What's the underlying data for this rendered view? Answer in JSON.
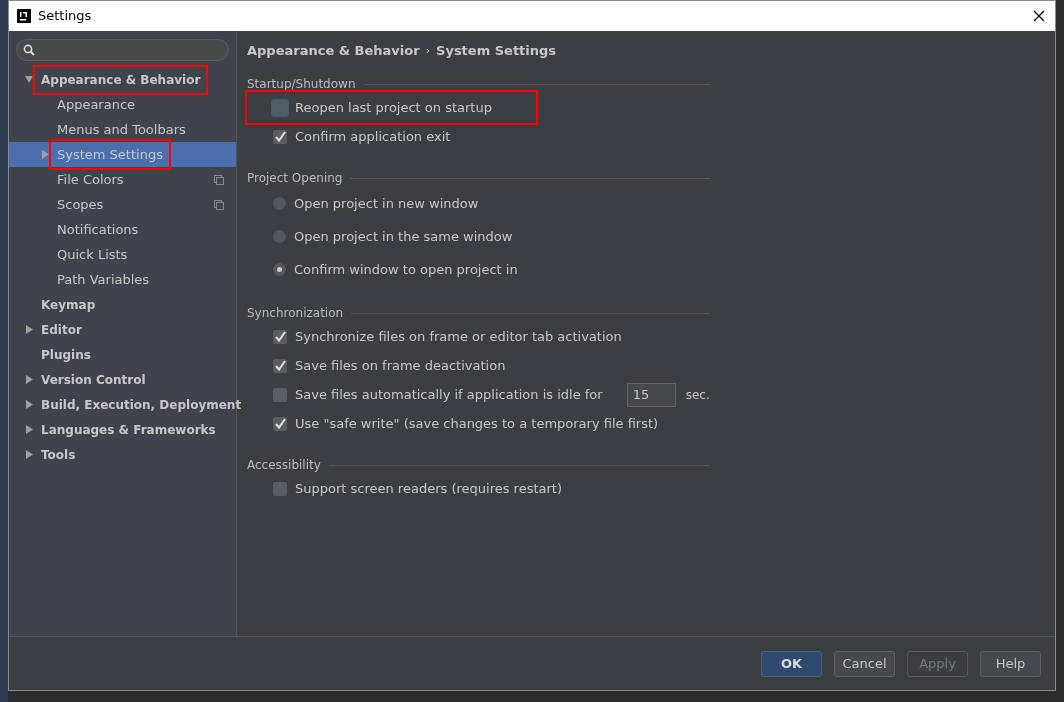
{
  "window": {
    "title": "Settings"
  },
  "sidebar": {
    "items": [
      {
        "label": "Appearance & Behavior",
        "expanded": true,
        "selected": false,
        "highlighted": true,
        "children": [
          {
            "label": "Appearance",
            "selected": false
          },
          {
            "label": "Menus and Toolbars",
            "selected": false
          },
          {
            "label": "System Settings",
            "expanded": false,
            "selected": true,
            "highlighted": true
          },
          {
            "label": "File Colors",
            "selected": false,
            "copy_icon": true
          },
          {
            "label": "Scopes",
            "selected": false,
            "copy_icon": true
          },
          {
            "label": "Notifications",
            "selected": false
          },
          {
            "label": "Quick Lists",
            "selected": false
          },
          {
            "label": "Path Variables",
            "selected": false
          }
        ]
      },
      {
        "label": "Keymap",
        "selected": false
      },
      {
        "label": "Editor",
        "expanded": false,
        "selected": false
      },
      {
        "label": "Plugins",
        "selected": false
      },
      {
        "label": "Version Control",
        "expanded": false,
        "selected": false
      },
      {
        "label": "Build, Execution, Deployment",
        "expanded": false,
        "selected": false
      },
      {
        "label": "Languages & Frameworks",
        "expanded": false,
        "selected": false
      },
      {
        "label": "Tools",
        "expanded": false,
        "selected": false
      }
    ]
  },
  "breadcrumb": {
    "parts": [
      "Appearance & Behavior",
      "System Settings"
    ],
    "separator": "›"
  },
  "sections": [
    {
      "title": "Startup/Shutdown",
      "items": [
        {
          "kind": "checkbox",
          "label": "Reopen last project on startup",
          "checked": false,
          "focused": true,
          "highlighted": true
        },
        {
          "kind": "checkbox",
          "label": "Confirm application exit",
          "checked": true
        }
      ]
    },
    {
      "title": "Project Opening",
      "items": [
        {
          "kind": "radio",
          "label": "Open project in new window",
          "selected": false
        },
        {
          "kind": "radio",
          "label": "Open project in the same window",
          "selected": false
        },
        {
          "kind": "radio",
          "label": "Confirm window to open project in",
          "selected": true
        }
      ]
    },
    {
      "title": "Synchronization",
      "items": [
        {
          "kind": "checkbox",
          "label": "Synchronize files on frame or editor tab activation",
          "checked": true
        },
        {
          "kind": "checkbox",
          "label": "Save files on frame deactivation",
          "checked": true
        },
        {
          "kind": "checkbox_field",
          "label": "Save files automatically if application is idle for",
          "checked": false,
          "value": "15",
          "unit": "sec."
        },
        {
          "kind": "checkbox",
          "label": "Use \"safe write\" (save changes to a temporary file first)",
          "checked": true
        }
      ]
    },
    {
      "title": "Accessibility",
      "items": [
        {
          "kind": "checkbox",
          "label": "Support screen readers (requires restart)",
          "checked": false
        }
      ]
    }
  ],
  "buttons": [
    {
      "label": "OK",
      "default": true,
      "disabled": false
    },
    {
      "label": "Cancel",
      "default": false,
      "disabled": false
    },
    {
      "label": "Apply",
      "default": false,
      "disabled": true
    },
    {
      "label": "Help",
      "default": false,
      "disabled": false
    }
  ]
}
